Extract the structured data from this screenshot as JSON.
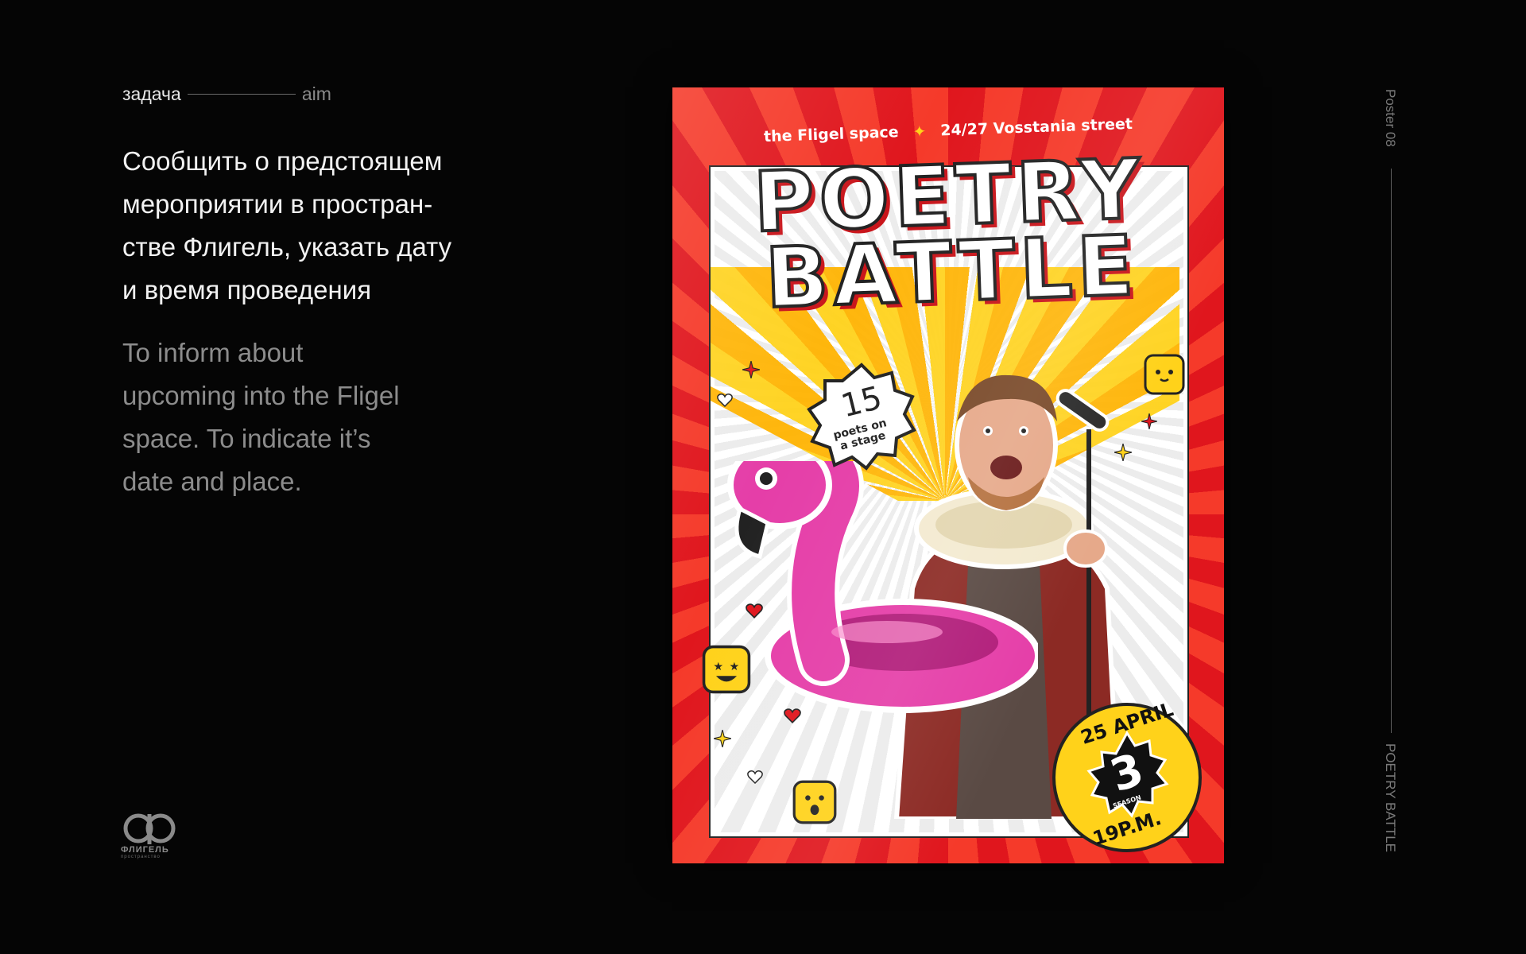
{
  "left": {
    "label_ru": "задача",
    "label_en": "aim",
    "body_ru_lines": [
      "Сообщить о предстоящем",
      "мероприятии в простран-",
      "стве Флигель, указать дату",
      "и время проведения"
    ],
    "body_en_lines": [
      "To inform about",
      "upcoming into the Fligel",
      "space. To indicate it’s",
      "date and place."
    ]
  },
  "logo": {
    "name": "ФЛИГЕЛЬ",
    "subtitle": "пространство"
  },
  "side_labels": {
    "top": "Poster 08",
    "bottom": "POETRY BATTLE"
  },
  "poster": {
    "venue": "the Fligel space",
    "address": "24/27 Vosstania street",
    "title_line1": "POETRY",
    "title_line2": "BATTLE",
    "poets_count": "15",
    "poets_label_1": "poets on",
    "poets_label_2": "a stage",
    "date": "25 APRIL",
    "time": "19P.M.",
    "season_number": "3",
    "season_label": "SEASON",
    "colors": {
      "red": "#e0161d",
      "yellow": "#ffd21a",
      "pink": "#e53ea8"
    }
  }
}
